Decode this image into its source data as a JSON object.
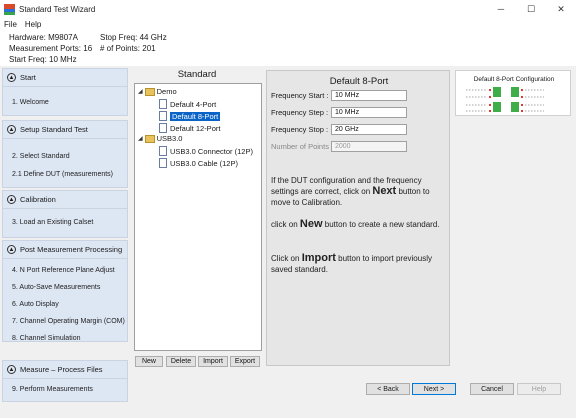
{
  "window": {
    "title": "Standard Test Wizard",
    "controls": [
      "─",
      "☐",
      "✕"
    ]
  },
  "menu": [
    "File",
    "Help"
  ],
  "info": {
    "hardware": "Hardware: M9807A",
    "ports": "Measurement Ports: 16",
    "start": "Start Freq: 10 MHz",
    "stop": "Stop Freq: 44 GHz",
    "points": "# of Points: 201"
  },
  "sidebar": [
    {
      "title": "Start",
      "items": [
        "1. Welcome"
      ]
    },
    {
      "title": "Setup Standard Test",
      "items": [
        "2. Select Standard",
        "2.1 Define DUT   (measurements)"
      ]
    },
    {
      "title": "Calibration",
      "items": [
        "3. Load an Existing Calset"
      ]
    },
    {
      "title": "Post Measurement Processing",
      "items": [
        "4. N Port Reference Plane Adjust",
        "5. Auto-Save Measurements",
        "6. Auto Display",
        "7. Channel Operating Margin (COM)",
        "8. Channel Simulation"
      ]
    },
    {
      "title": "Measure – Process Files",
      "items": [
        "9. Perform Measurements"
      ]
    }
  ],
  "standard": {
    "heading": "Standard",
    "tree": {
      "demo": "Demo",
      "demo_items": [
        "Default 4-Port",
        "Default 8-Port",
        "Default 12-Port"
      ],
      "usb": "USB3.0",
      "usb_items": [
        "USB3.0 Connector (12P)",
        "USB3.0 Cable (12P)"
      ]
    },
    "buttons": [
      "New",
      "Delete",
      "Import",
      "Export"
    ]
  },
  "detail": {
    "title": "Default 8-Port",
    "fields": [
      {
        "label": "Frequency Start :",
        "value": "10 MHz"
      },
      {
        "label": "Frequency Step :",
        "value": "10 MHz"
      },
      {
        "label": "Frequency Stop :",
        "value": "20 GHz"
      },
      {
        "label": "Number of Points :",
        "value": "2000"
      }
    ],
    "help1_a": "If the DUT configuration and the frequency settings are correct, click on ",
    "help1_b": "Next",
    "help1_c": " button to move to Calibration.",
    "help2_a": "click on ",
    "help2_b": "New",
    "help2_c": " button to create a new standard.",
    "help3_a": "Click on ",
    "help3_b": "Import",
    "help3_c": " button to import previously saved standard."
  },
  "config": {
    "title": "Default 8-Port Configuration"
  },
  "nav": {
    "back": "< Back",
    "next": "Next >",
    "cancel": "Cancel",
    "help": "Help"
  }
}
